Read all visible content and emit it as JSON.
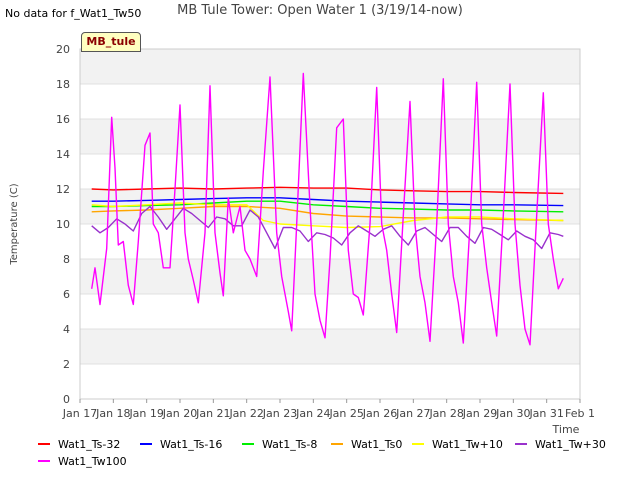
{
  "header": {
    "no_data_text": "No data for f_Wat1_Tw50",
    "title": "MB Tule Tower: Open Water 1 (3/19/14-now)",
    "tag": "MB_tule"
  },
  "chart_data": {
    "type": "line",
    "title": "MB Tule Tower: Open Water 1 (3/19/14-now)",
    "xlabel": "Time",
    "ylabel": "Temperature (C)",
    "ylim": [
      0,
      20
    ],
    "xlim": [
      0,
      15
    ],
    "yticks": [
      0,
      2,
      4,
      6,
      8,
      10,
      12,
      14,
      16,
      18,
      20
    ],
    "xtick_labels": [
      "Jan 17",
      "Jan 18",
      "Jan 19",
      "Jan 20",
      "Jan 21",
      "Jan 22",
      "Jan 23",
      "Jan 24",
      "Jan 25",
      "Jan 26",
      "Jan 27",
      "Jan 28",
      "Jan 29",
      "Jan 30",
      "Jan 31",
      "Feb 1"
    ],
    "grid": true,
    "legend_position": "bottom",
    "series": [
      {
        "name": "Wat1_Ts-32",
        "color": "#ff0000",
        "x": [
          0.35,
          1,
          2,
          3,
          4,
          5,
          6,
          7,
          8,
          9,
          10,
          11,
          12,
          13,
          14.5
        ],
        "y": [
          12.0,
          11.95,
          12.0,
          12.05,
          12.0,
          12.05,
          12.1,
          12.05,
          12.05,
          11.95,
          11.9,
          11.85,
          11.85,
          11.8,
          11.75
        ]
      },
      {
        "name": "Wat1_Ts-16",
        "color": "#0000ff",
        "x": [
          0.35,
          1,
          2,
          3,
          4,
          5,
          6,
          7,
          8,
          9,
          10,
          11,
          12,
          13,
          14.5
        ],
        "y": [
          11.3,
          11.3,
          11.35,
          11.4,
          11.45,
          11.5,
          11.5,
          11.4,
          11.3,
          11.25,
          11.2,
          11.15,
          11.1,
          11.1,
          11.05
        ]
      },
      {
        "name": "Wat1_Ts-8",
        "color": "#00ee00",
        "x": [
          0.35,
          1,
          2,
          3,
          4,
          5,
          6,
          7,
          8,
          9,
          10,
          11,
          12,
          13,
          14.5
        ],
        "y": [
          11.0,
          11.0,
          11.05,
          11.1,
          11.2,
          11.3,
          11.3,
          11.1,
          11.0,
          10.9,
          10.85,
          10.8,
          10.8,
          10.75,
          10.7
        ]
      },
      {
        "name": "Wat1_Ts0",
        "color": "#ffa500",
        "x": [
          0.35,
          1,
          2,
          3,
          4,
          5,
          6,
          7,
          8,
          9,
          10,
          11,
          12,
          13,
          14.5
        ],
        "y": [
          10.7,
          10.75,
          10.8,
          10.9,
          11.0,
          11.0,
          10.9,
          10.6,
          10.45,
          10.4,
          10.35,
          10.35,
          10.3,
          10.25,
          10.2
        ]
      },
      {
        "name": "Wat1_Tw+10",
        "color": "#ffff00",
        "x": [
          0.35,
          1,
          2,
          3,
          4,
          5,
          5.5,
          6,
          7,
          8,
          9,
          10,
          11,
          12,
          13,
          14.5
        ],
        "y": [
          11.1,
          11.0,
          11.1,
          11.2,
          11.1,
          11.1,
          10.2,
          10.0,
          9.9,
          9.8,
          9.85,
          10.2,
          10.4,
          10.4,
          10.3,
          10.2
        ]
      },
      {
        "name": "Wat1_Tw+30",
        "color": "#9932cc",
        "x": [
          0.35,
          0.6,
          0.85,
          1.1,
          1.35,
          1.6,
          1.85,
          2.1,
          2.35,
          2.6,
          2.85,
          3.1,
          3.35,
          3.6,
          3.85,
          4.1,
          4.35,
          4.6,
          4.85,
          5.1,
          5.35,
          5.6,
          5.85,
          6.1,
          6.35,
          6.6,
          6.85,
          7.1,
          7.35,
          7.6,
          7.85,
          8.1,
          8.35,
          8.6,
          8.85,
          9.1,
          9.35,
          9.6,
          9.85,
          10.1,
          10.35,
          10.6,
          10.85,
          11.1,
          11.35,
          11.6,
          11.85,
          12.1,
          12.35,
          12.6,
          12.85,
          13.1,
          13.35,
          13.6,
          13.85,
          14.1,
          14.35,
          14.5
        ],
        "y": [
          9.9,
          9.5,
          9.8,
          10.3,
          10.0,
          9.6,
          10.6,
          11.0,
          10.4,
          9.7,
          10.3,
          10.9,
          10.6,
          10.2,
          9.8,
          10.4,
          10.3,
          9.9,
          9.9,
          10.8,
          10.4,
          9.5,
          8.6,
          9.8,
          9.8,
          9.6,
          9.0,
          9.5,
          9.4,
          9.2,
          8.8,
          9.5,
          9.9,
          9.6,
          9.3,
          9.7,
          9.9,
          9.3,
          8.8,
          9.6,
          9.8,
          9.4,
          9.0,
          9.8,
          9.8,
          9.3,
          8.9,
          9.8,
          9.7,
          9.4,
          9.1,
          9.6,
          9.3,
          9.1,
          8.6,
          9.5,
          9.4,
          9.3
        ]
      },
      {
        "name": "Wat1_Tw100",
        "color": "#ff00ff",
        "x": [
          0.35,
          0.45,
          0.6,
          0.8,
          0.95,
          1.05,
          1.15,
          1.3,
          1.45,
          1.6,
          1.75,
          1.95,
          2.1,
          2.2,
          2.35,
          2.5,
          2.7,
          2.85,
          3.0,
          3.15,
          3.25,
          3.4,
          3.55,
          3.75,
          3.9,
          4.05,
          4.2,
          4.3,
          4.45,
          4.6,
          4.8,
          4.95,
          5.1,
          5.3,
          5.5,
          5.7,
          5.9,
          6.05,
          6.25,
          6.35,
          6.5,
          6.7,
          6.9,
          7.05,
          7.2,
          7.35,
          7.5,
          7.7,
          7.9,
          8.05,
          8.2,
          8.35,
          8.5,
          8.7,
          8.9,
          9.05,
          9.2,
          9.35,
          9.5,
          9.7,
          9.9,
          10.05,
          10.2,
          10.35,
          10.5,
          10.7,
          10.9,
          11.05,
          11.2,
          11.35,
          11.5,
          11.7,
          11.9,
          12.05,
          12.2,
          12.35,
          12.5,
          12.7,
          12.9,
          13.05,
          13.2,
          13.35,
          13.5,
          13.7,
          13.9,
          14.05,
          14.2,
          14.35,
          14.5
        ],
        "y": [
          6.3,
          7.5,
          5.4,
          8.6,
          16.1,
          13.2,
          8.8,
          9.0,
          6.5,
          5.4,
          9.0,
          14.5,
          15.2,
          10.0,
          9.5,
          7.5,
          7.5,
          12.0,
          16.8,
          9.5,
          8.0,
          6.8,
          5.5,
          9.5,
          17.9,
          9.5,
          7.2,
          5.9,
          11.5,
          9.5,
          11.0,
          8.5,
          8.0,
          7.0,
          13.0,
          18.4,
          9.5,
          7.0,
          5.0,
          3.9,
          10.0,
          18.6,
          11.0,
          6.0,
          4.5,
          3.5,
          8.0,
          15.5,
          16.0,
          8.5,
          6.0,
          5.8,
          4.8,
          10.0,
          17.8,
          10.0,
          8.5,
          6.0,
          3.8,
          10.5,
          17.0,
          10.0,
          7.0,
          5.5,
          3.3,
          10.0,
          18.3,
          10.0,
          7.0,
          5.5,
          3.2,
          10.0,
          18.1,
          10.0,
          7.5,
          5.5,
          3.6,
          10.5,
          18.0,
          10.0,
          6.5,
          4.0,
          3.1,
          10.5,
          17.5,
          10.0,
          8.0,
          6.3,
          6.9
        ]
      }
    ]
  }
}
